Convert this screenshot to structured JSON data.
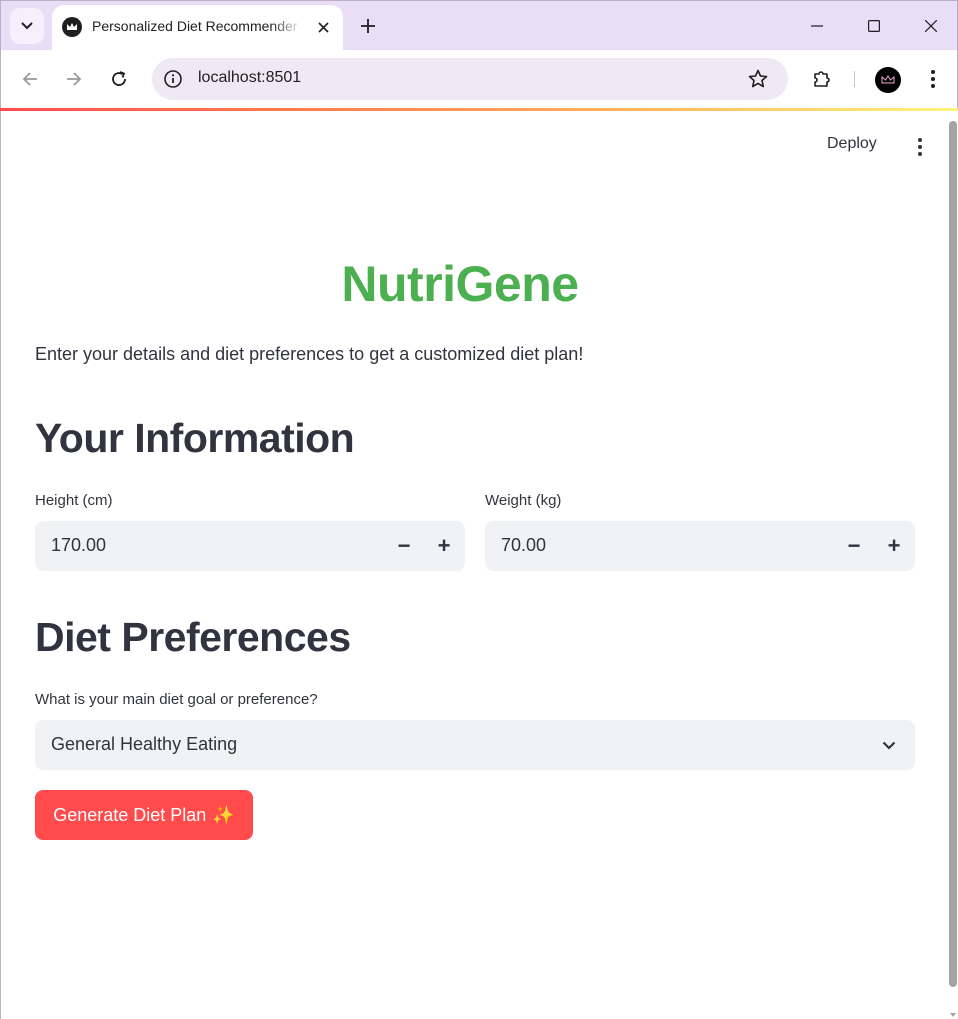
{
  "browser": {
    "tab_title": "Personalized Diet Recommender",
    "url": "localhost:8501",
    "icons": {
      "tab_dropdown": "chevron-down-icon",
      "favicon": "crown-icon",
      "tab_close": "close-icon",
      "new_tab": "plus-icon",
      "minimize": "minimize-icon",
      "maximize": "maximize-icon",
      "close": "close-icon",
      "back": "arrow-left-icon",
      "forward": "arrow-right-icon",
      "reload": "reload-icon",
      "site_info": "info-icon",
      "bookmark": "star-icon",
      "extensions": "puzzle-icon",
      "menu": "kebab-icon"
    }
  },
  "app": {
    "deploy_label": "Deploy",
    "title": "NutriGene",
    "intro": "Enter your details and diet preferences to get a customized diet plan!",
    "section_info": "Your Information",
    "height": {
      "label": "Height (cm)",
      "value": "170.00"
    },
    "weight": {
      "label": "Weight (kg)",
      "value": "70.00"
    },
    "stepper_minus": "−",
    "stepper_plus": "+",
    "section_diet": "Diet Preferences",
    "diet_question": "What is your main diet goal or preference?",
    "diet_selected": "General Healthy Eating",
    "generate_label": "Generate Diet Plan",
    "generate_emoji": "✨"
  },
  "colors": {
    "title_green": "#4caf50",
    "button_red": "#ff4b4b",
    "input_bg": "#f0f2f6",
    "chrome_bg": "#e9def5"
  }
}
